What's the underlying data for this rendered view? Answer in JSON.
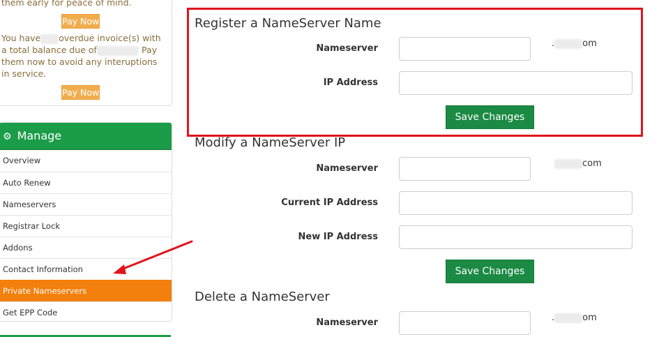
{
  "sidebar": {
    "alert": {
      "line_top": "them early for peace of mind.",
      "pay_now_label_1": "Pay Now",
      "text_part_1": "You have",
      "text_part_2": "overdue invoice(s) with a total balance due of",
      "text_part_3": "Pay them now to avoid any interuptions in service.",
      "pay_now_label_2": "Pay Now"
    },
    "manage": {
      "title": "Manage",
      "title_icon": "gear-icon",
      "items": [
        {
          "label": "Overview"
        },
        {
          "label": "Auto Renew"
        },
        {
          "label": "Nameservers"
        },
        {
          "label": "Registrar Lock"
        },
        {
          "label": "Addons"
        },
        {
          "label": "Contact Information"
        },
        {
          "label": "Private Nameservers",
          "active": true
        },
        {
          "label": "Get EPP Code"
        }
      ]
    }
  },
  "main": {
    "register": {
      "title": "Register a NameServer Name",
      "nameserver_label": "Nameserver",
      "nameserver_value": "",
      "domain_suffix": "om",
      "ip_label": "IP Address",
      "ip_value": "",
      "save_label": "Save Changes"
    },
    "modify": {
      "title": "Modify a NameServer IP",
      "nameserver_label": "Nameserver",
      "nameserver_value": "",
      "domain_suffix": "com",
      "current_ip_label": "Current IP Address",
      "current_ip_value": "",
      "new_ip_label": "New IP Address",
      "new_ip_value": "",
      "save_label": "Save Changes"
    },
    "delete": {
      "title": "Delete a NameServer",
      "nameserver_label": "Nameserver",
      "nameserver_value": "",
      "domain_suffix": "om"
    }
  },
  "colors": {
    "manage_green": "#1b9c49",
    "active_orange": "#f37f0c",
    "pay_button": "#f0ad4e",
    "save_button": "#1b8a44",
    "highlight_red": "#e0141c",
    "alert_text": "#8a6d3b"
  }
}
